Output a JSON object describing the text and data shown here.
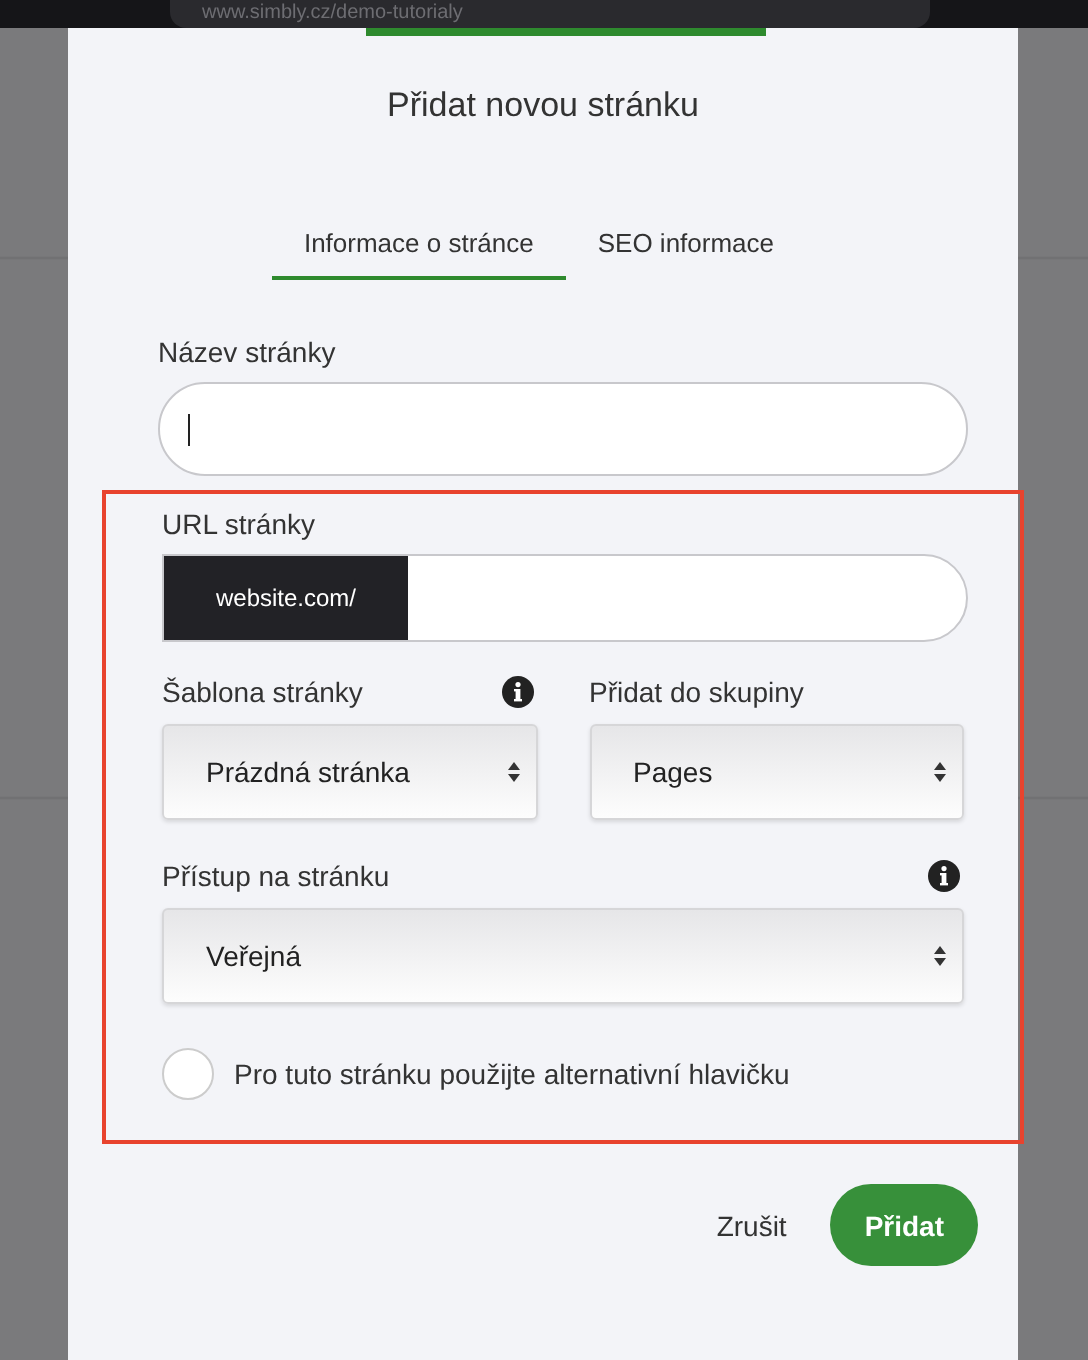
{
  "browser_bar": {
    "address": "www.simbly.cz/demo-tutorialy"
  },
  "dialog": {
    "title": "Přidat novou stránku",
    "tabs": [
      {
        "label": "Informace o stránce",
        "selected": true
      },
      {
        "label": "SEO informace",
        "selected": false
      }
    ],
    "name_field": {
      "label": "Název stránky",
      "focused": true
    },
    "url_field": {
      "label": "URL stránky",
      "prefix": "website.com/"
    },
    "template": {
      "label": "Šablona stránky",
      "value": "Prázdná stránka",
      "info": true
    },
    "group": {
      "label": "Přidat do skupiny",
      "value": "Pages"
    },
    "access": {
      "label": "Přístup na stránku",
      "value": "Veřejná",
      "info": true
    },
    "alt_header": {
      "label": "Pro tuto stránku použijte alternativní hlavičku",
      "checked": false
    },
    "buttons": [
      {
        "label": "Zrušit",
        "kind": "text"
      },
      {
        "label": "Přidat",
        "kind": "primary"
      }
    ]
  }
}
